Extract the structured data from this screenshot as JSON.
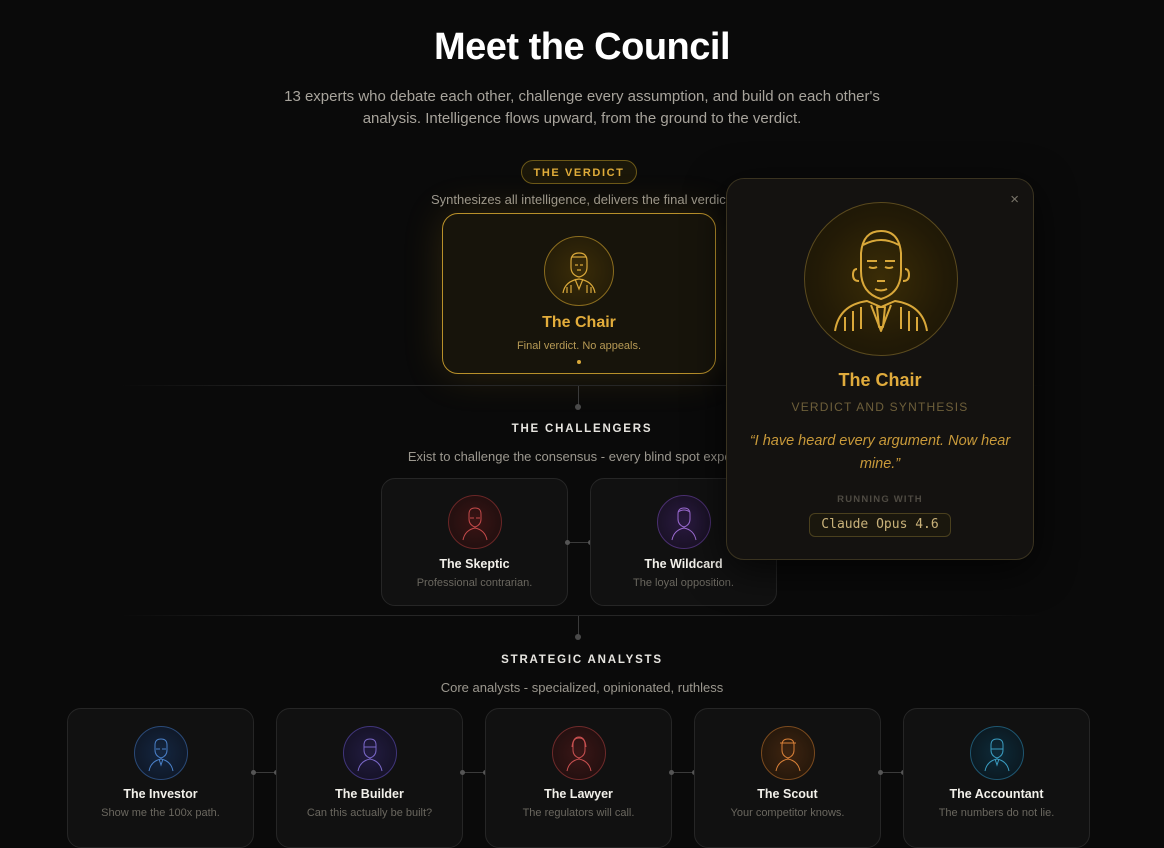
{
  "page": {
    "title": "Meet the Council",
    "subtitle": "13 experts who debate each other, challenge every assumption, and build on each other's analysis. Intelligence flows upward, from the ground to the verdict."
  },
  "verdict": {
    "pill": "THE VERDICT",
    "description": "Synthesizes all intelligence, delivers the final verdict.",
    "card": {
      "name": "The Chair",
      "tagline": "Final verdict. No appeals."
    }
  },
  "challengers": {
    "label": "THE CHALLENGERS",
    "description": "Exist to challenge the consensus - every blind spot exposed.",
    "cards": [
      {
        "name": "The Skeptic",
        "tagline": "Professional contrarian."
      },
      {
        "name": "The Wildcard",
        "tagline": "The loyal opposition."
      }
    ]
  },
  "analysts": {
    "label": "STRATEGIC ANALYSTS",
    "description": "Core analysts - specialized, opinionated, ruthless",
    "cards": [
      {
        "name": "The Investor",
        "tagline": "Show me the 100x path."
      },
      {
        "name": "The Builder",
        "tagline": "Can this actually be built?"
      },
      {
        "name": "The Lawyer",
        "tagline": "The regulators will call."
      },
      {
        "name": "The Scout",
        "tagline": "Your competitor knows."
      },
      {
        "name": "The Accountant",
        "tagline": "The numbers do not lie."
      }
    ]
  },
  "popup": {
    "name": "The Chair",
    "role": "VERDICT AND SYNTHESIS",
    "quote": "“I have heard every argument. Now hear mine.”",
    "running_label": "RUNNING WITH",
    "model": "Claude Opus 4.6",
    "close_icon": "×"
  },
  "colors": {
    "gold": "#d9a83a",
    "skeptic": "#b43c3c",
    "wildcard": "#8e5cc7",
    "investor": "#3f6fb8",
    "builder": "#6e5cc0",
    "lawyer": "#c04848",
    "scout": "#d07830",
    "accountant": "#3a8fb0"
  }
}
